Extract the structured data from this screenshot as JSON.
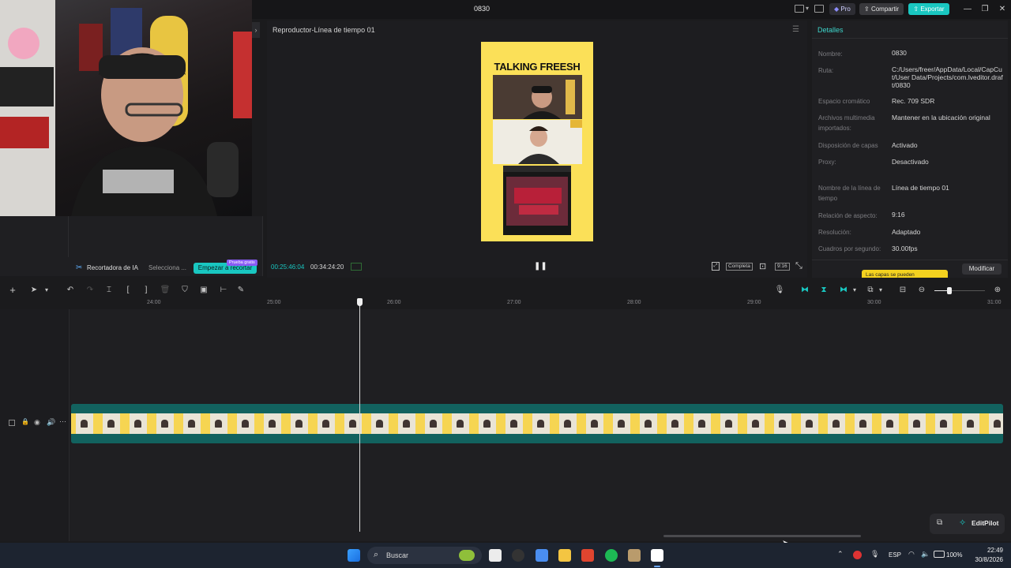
{
  "app": {
    "title": "0830",
    "pro_label": "Pro",
    "share_label": "Compartir",
    "export_label": "Exportar"
  },
  "left_panel": {
    "ai_cutter_label": "Recortadora de IA",
    "select_label": "Selecciona ...",
    "start_cut_label": "Empezar a recortar",
    "trial_badge": "Prueba gratis"
  },
  "player": {
    "title": "Reproductor-Línea de tiempo 01",
    "current_time": "00:25:46:04",
    "total_time": "00:34:24:20",
    "quality_label": "Completa",
    "ratio_label": "9:16",
    "canvas_title": "TALKING FREESH"
  },
  "details": {
    "heading": "Detalles",
    "rows": [
      {
        "label": "Nombre:",
        "value": "0830"
      },
      {
        "label": "Ruta:",
        "value": "C:/Users/freer/AppData/Local/CapCut/User Data/Projects/com.lveditor.draft/0830"
      },
      {
        "label": "Espacio cromático",
        "value": "Rec. 709 SDR"
      },
      {
        "label": "Archivos multimedia importados:",
        "value": "Mantener en la ubicación original"
      },
      {
        "label": "Disposición de capas",
        "value": "Activado"
      },
      {
        "label": "Proxy:",
        "value": "Desactivado"
      },
      {
        "label": "Nombre de la línea de tiempo",
        "value": "Línea de tiempo 01"
      },
      {
        "label": "Relación de aspecto:",
        "value": "9:16"
      },
      {
        "label": "Resolución:",
        "value": "Adaptado"
      },
      {
        "label": "Cuadros por segundo:",
        "value": "30.00fps"
      }
    ],
    "tooltip": "Las capas se pueden",
    "modify_label": "Modificar"
  },
  "ruler": {
    "ticks": [
      "24:00",
      "25:00",
      "26:00",
      "27:00",
      "28:00",
      "29:00",
      "30:00",
      "31:00"
    ]
  },
  "editpilot": {
    "label": "EditPilot"
  },
  "taskbar": {
    "search_placeholder": "Buscar",
    "language": "ESP",
    "battery": "100%",
    "time": "22:49",
    "date": "30/8/2026"
  },
  "colors": {
    "accent": "#19c7c1",
    "canvas_bg": "#fbe058",
    "clip_bg": "#12625f",
    "panel_bg": "#1f1f22"
  }
}
